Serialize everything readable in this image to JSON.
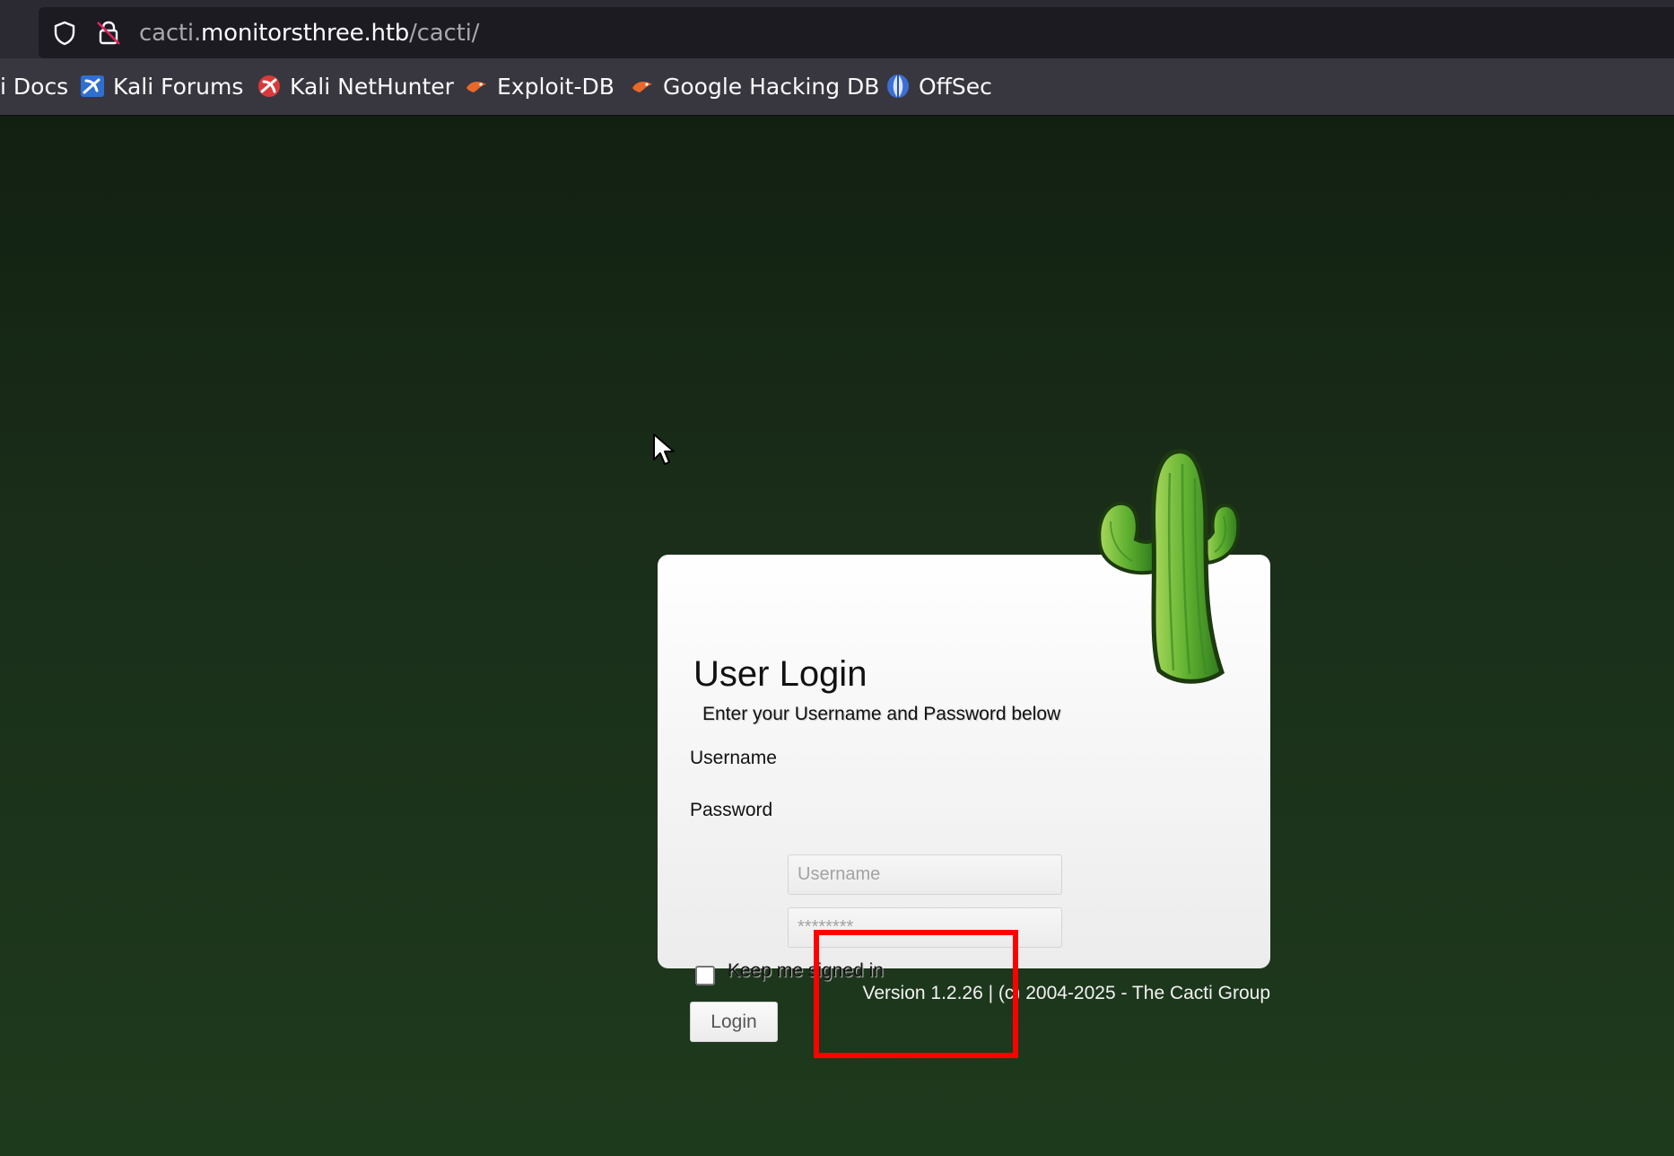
{
  "browser": {
    "url": {
      "subdomain": "cacti.",
      "domain": "monitorsthree.htb",
      "path": "/cacti/"
    },
    "bookmarks": [
      {
        "label": "i Docs",
        "icon": "kali-docs-icon"
      },
      {
        "label": "Kali Forums",
        "icon": "kali-forums-icon"
      },
      {
        "label": "Kali NetHunter",
        "icon": "kali-nethunter-icon"
      },
      {
        "label": "Exploit-DB",
        "icon": "exploit-db-icon"
      },
      {
        "label": "Google Hacking DB",
        "icon": "ghdb-icon"
      },
      {
        "label": "OffSec",
        "icon": "offsec-icon"
      }
    ]
  },
  "login": {
    "title": "User Login",
    "subtitle": "Enter your Username and Password below",
    "username_label": "Username",
    "username_placeholder": "Username",
    "password_label": "Password",
    "password_placeholder": "********",
    "remember_label": "Keep me signed in",
    "remember_checked": false,
    "submit_label": "Login"
  },
  "footer": {
    "version_text": "Version 1.2.26 | (c) 2004-2025 - The Cacti Group"
  },
  "colors": {
    "background_top": "#122012",
    "background_bottom": "#1e3a1d",
    "highlight": "#ff0000"
  }
}
